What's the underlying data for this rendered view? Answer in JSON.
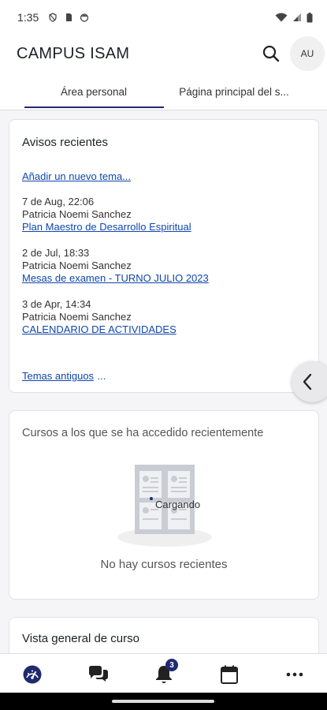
{
  "status_bar": {
    "time": "1:35",
    "icons": [
      "shield-icon",
      "sim-icon",
      "face-icon",
      "wifi-icon",
      "signal-icon",
      "battery-icon"
    ]
  },
  "header": {
    "title": "CAMPUS ISAM",
    "avatar_initials": "AU",
    "search_icon": "search-icon"
  },
  "tabs": [
    {
      "label": "Área personal",
      "selected": true
    },
    {
      "label": "Página principal del s..."
    }
  ],
  "avisos": {
    "title": "Avisos recientes",
    "add_link": "Añadir un nuevo tema...",
    "posts": [
      {
        "date": "7 de Aug, 22:06",
        "author": "Patricia Noemi Sanchez",
        "subject": "Plan Maestro de Desarrollo Espiritual"
      },
      {
        "date": "2 de Jul, 18:33",
        "author": "Patricia Noemi Sanchez",
        "subject": "Mesas de examen - TURNO JULIO 2023"
      },
      {
        "date": "3 de Apr, 14:34",
        "author": "Patricia Noemi Sanchez",
        "subject": "CALENDARIO DE ACTIVIDADES"
      }
    ],
    "old_topics_link": "Temas antiguos",
    "old_topics_suffix": "..."
  },
  "cursos": {
    "title": "Cursos a los que se ha accedido recientemente",
    "loading": "Cargando",
    "empty_message": "No hay cursos recientes"
  },
  "vista_general": {
    "title": "Vista general de curso"
  },
  "bottom_nav": {
    "items": [
      "dashboard-icon",
      "messages-icon",
      "notifications-icon",
      "calendar-icon",
      "more-icon"
    ],
    "notifications_badge": "3"
  },
  "colors": {
    "accent": "#1f2a6e",
    "link": "#0f47ad",
    "background": "#f5f5f7"
  }
}
